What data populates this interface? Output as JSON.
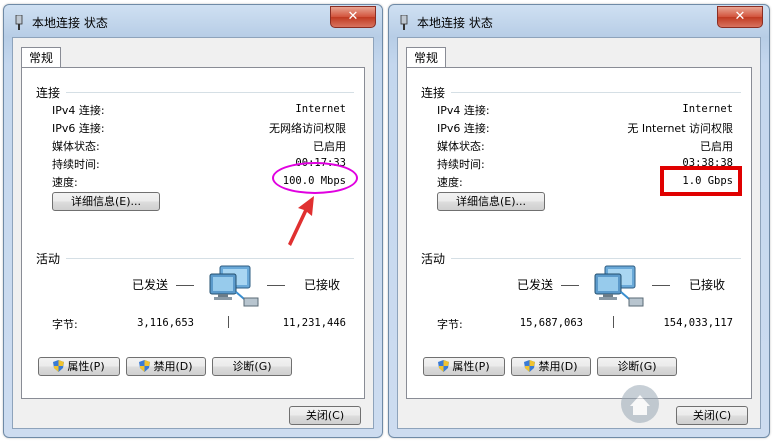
{
  "windows": [
    {
      "title": "本地连接 状态",
      "close_symbol": "✕",
      "tab": "常规",
      "connection": {
        "section": "连接",
        "ipv4_label": "IPv4 连接:",
        "ipv4_value": "Internet",
        "ipv6_label": "IPv6 连接:",
        "ipv6_value": "无网络访问权限",
        "media_label": "媒体状态:",
        "media_value": "已启用",
        "duration_label": "持续时间:",
        "duration_value": "00:17:33",
        "speed_label": "速度:",
        "speed_value": "100.0 Mbps",
        "details_button": "详细信息(E)..."
      },
      "activity": {
        "section": "活动",
        "sent_label": "已发送",
        "received_label": "已接收",
        "bytes_label": "字节:",
        "bytes_sent": "3,116,653",
        "bytes_received": "11,231,446"
      },
      "buttons": {
        "properties": "属性(P)",
        "disable": "禁用(D)",
        "diagnose": "诊断(G)",
        "close": "关闭(C)"
      }
    },
    {
      "title": "本地连接 状态",
      "close_symbol": "✕",
      "tab": "常规",
      "connection": {
        "section": "连接",
        "ipv4_label": "IPv4 连接:",
        "ipv4_value": "Internet",
        "ipv6_label": "IPv6 连接:",
        "ipv6_value": "无 Internet 访问权限",
        "media_label": "媒体状态:",
        "media_value": "已启用",
        "duration_label": "持续时间:",
        "duration_value": "03:38:38",
        "speed_label": "速度:",
        "speed_value": "1.0 Gbps",
        "details_button": "详细信息(E)..."
      },
      "activity": {
        "section": "活动",
        "sent_label": "已发送",
        "received_label": "已接收",
        "bytes_label": "字节:",
        "bytes_sent": "15,687,063",
        "bytes_received": "154,033,117"
      },
      "buttons": {
        "properties": "属性(P)",
        "disable": "禁用(D)",
        "diagnose": "诊断(G)",
        "close": "关闭(C)"
      }
    }
  ],
  "colors": {
    "annotation_ellipse": "#e000e0",
    "annotation_rect": "#e00000",
    "annotation_arrow": "#e03030"
  }
}
